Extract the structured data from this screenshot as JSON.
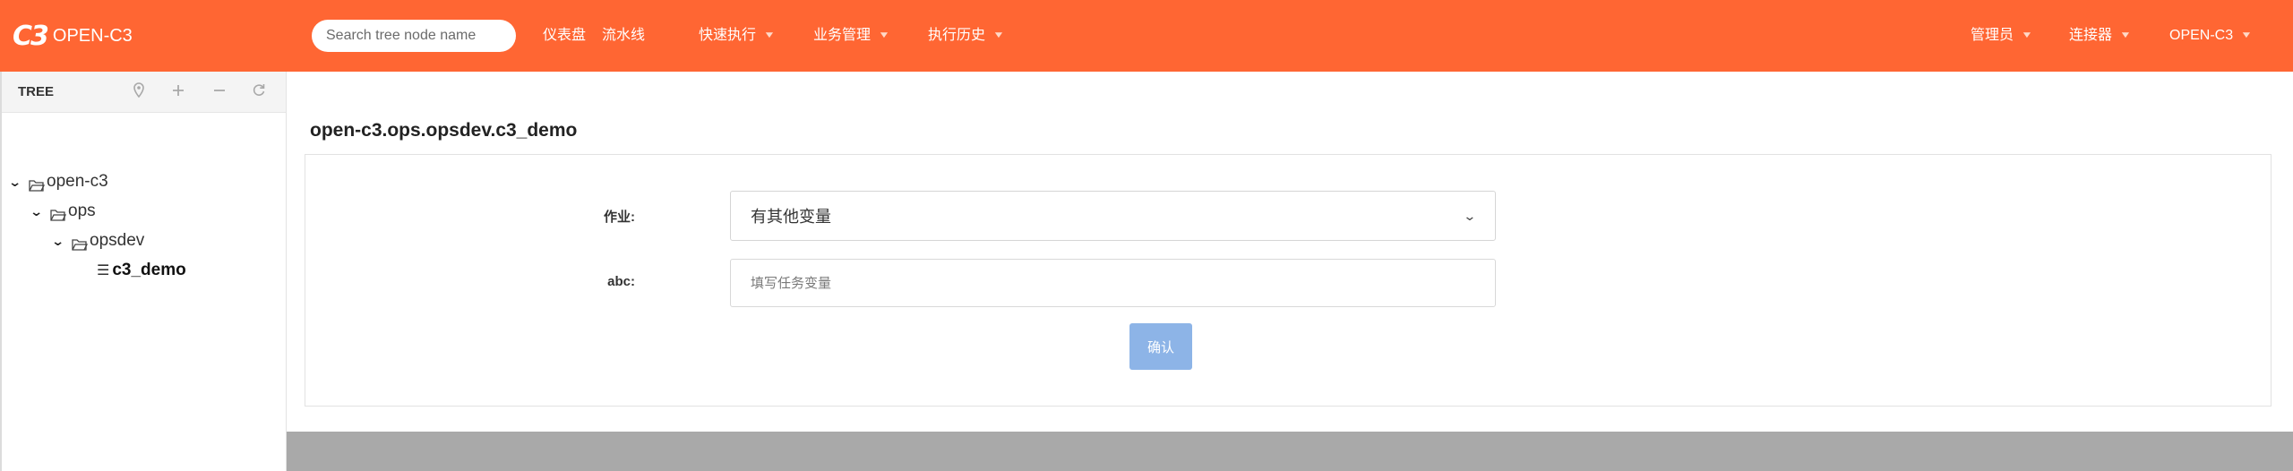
{
  "header": {
    "logo_mark": "C3",
    "logo_text": "OPEN-C3",
    "search_placeholder": "Search tree node name",
    "nav_left": [
      {
        "label": "仪表盘",
        "has_caret": false
      },
      {
        "label": "流水线",
        "has_caret": false
      },
      {
        "label": "快速执行",
        "has_caret": true
      },
      {
        "label": "业务管理",
        "has_caret": true
      },
      {
        "label": "执行历史",
        "has_caret": true
      }
    ],
    "nav_right": [
      {
        "label": "管理员",
        "has_caret": true
      },
      {
        "label": "连接器",
        "has_caret": true
      },
      {
        "label": "OPEN-C3",
        "has_caret": true
      }
    ],
    "colors": {
      "bar": "#ff6633"
    }
  },
  "sidebar": {
    "title": "TREE",
    "tools": [
      "location-icon",
      "add-icon",
      "minus-icon",
      "refresh-icon"
    ],
    "nodes": [
      {
        "label": "open-c3",
        "level": 0,
        "type": "folder",
        "expanded": true
      },
      {
        "label": "ops",
        "level": 1,
        "type": "folder",
        "expanded": true
      },
      {
        "label": "opsdev",
        "level": 2,
        "type": "folder",
        "expanded": true
      },
      {
        "label": "c3_demo",
        "level": 3,
        "type": "leaf",
        "selected": true
      }
    ]
  },
  "main": {
    "title": "open-c3.ops.opsdev.c3_demo",
    "form": {
      "job_label": "作业:",
      "job_value": "有其他变量",
      "abc_label": "abc:",
      "abc_placeholder": "填写任务变量",
      "confirm_label": "确认"
    }
  }
}
